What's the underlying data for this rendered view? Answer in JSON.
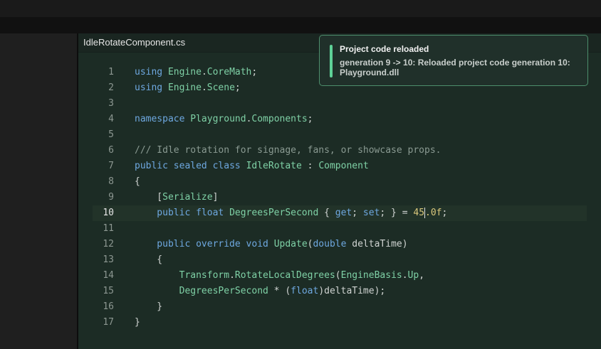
{
  "editor": {
    "tab_title": "IdleRotateComponent.cs",
    "lines": [
      {
        "n": "1",
        "tokens": [
          {
            "t": "using ",
            "c": "kw"
          },
          {
            "t": "Engine",
            "c": "ty"
          },
          {
            "t": ".",
            "c": "pl"
          },
          {
            "t": "CoreMath",
            "c": "ty"
          },
          {
            "t": ";",
            "c": "pl"
          }
        ]
      },
      {
        "n": "2",
        "tokens": [
          {
            "t": "using ",
            "c": "kw"
          },
          {
            "t": "Engine",
            "c": "ty"
          },
          {
            "t": ".",
            "c": "pl"
          },
          {
            "t": "Scene",
            "c": "ty"
          },
          {
            "t": ";",
            "c": "pl"
          }
        ]
      },
      {
        "n": "3",
        "tokens": []
      },
      {
        "n": "4",
        "tokens": [
          {
            "t": "namespace ",
            "c": "kw"
          },
          {
            "t": "Playground",
            "c": "ty"
          },
          {
            "t": ".",
            "c": "pl"
          },
          {
            "t": "Components",
            "c": "ty"
          },
          {
            "t": ";",
            "c": "pl"
          }
        ]
      },
      {
        "n": "5",
        "tokens": []
      },
      {
        "n": "6",
        "tokens": [
          {
            "t": "/// Idle rotation for signage, fans, or showcase props.",
            "c": "cm"
          }
        ]
      },
      {
        "n": "7",
        "tokens": [
          {
            "t": "public ",
            "c": "kw"
          },
          {
            "t": "sealed ",
            "c": "kw"
          },
          {
            "t": "class ",
            "c": "kw"
          },
          {
            "t": "IdleRotate",
            "c": "ty"
          },
          {
            "t": " : ",
            "c": "pl"
          },
          {
            "t": "Component",
            "c": "ty"
          }
        ]
      },
      {
        "n": "8",
        "tokens": [
          {
            "t": "{",
            "c": "pl"
          }
        ]
      },
      {
        "n": "9",
        "tokens": [
          {
            "t": "    [",
            "c": "pl"
          },
          {
            "t": "Serialize",
            "c": "ty"
          },
          {
            "t": "]",
            "c": "pl"
          }
        ]
      },
      {
        "n": "10",
        "active": true,
        "tokens": [
          {
            "t": "    public ",
            "c": "kw"
          },
          {
            "t": "float ",
            "c": "kw"
          },
          {
            "t": "DegreesPerSecond",
            "c": "ty"
          },
          {
            "t": " { ",
            "c": "pl"
          },
          {
            "t": "get",
            "c": "kw"
          },
          {
            "t": "; ",
            "c": "pl"
          },
          {
            "t": "set",
            "c": "kw"
          },
          {
            "t": "; } = ",
            "c": "pl"
          },
          {
            "t": "45",
            "c": "num"
          },
          {
            "t": "|",
            "c": "caret"
          },
          {
            "t": ".0f",
            "c": "num"
          },
          {
            "t": ";",
            "c": "pl"
          }
        ]
      },
      {
        "n": "11",
        "tokens": []
      },
      {
        "n": "12",
        "tokens": [
          {
            "t": "    public ",
            "c": "kw"
          },
          {
            "t": "override ",
            "c": "kw"
          },
          {
            "t": "void ",
            "c": "kw"
          },
          {
            "t": "Update",
            "c": "ty"
          },
          {
            "t": "(",
            "c": "pl"
          },
          {
            "t": "double ",
            "c": "kw"
          },
          {
            "t": "deltaTime)",
            "c": "pl"
          }
        ]
      },
      {
        "n": "13",
        "tokens": [
          {
            "t": "    {",
            "c": "pl"
          }
        ]
      },
      {
        "n": "14",
        "tokens": [
          {
            "t": "        ",
            "c": "pl"
          },
          {
            "t": "Transform",
            "c": "ty"
          },
          {
            "t": ".",
            "c": "pl"
          },
          {
            "t": "RotateLocalDegrees",
            "c": "ty"
          },
          {
            "t": "(",
            "c": "pl"
          },
          {
            "t": "EngineBasis",
            "c": "ty"
          },
          {
            "t": ".",
            "c": "pl"
          },
          {
            "t": "Up",
            "c": "ty"
          },
          {
            "t": ",",
            "c": "pl"
          }
        ]
      },
      {
        "n": "15",
        "tokens": [
          {
            "t": "        ",
            "c": "pl"
          },
          {
            "t": "DegreesPerSecond",
            "c": "ty"
          },
          {
            "t": " * (",
            "c": "pl"
          },
          {
            "t": "float",
            "c": "kw"
          },
          {
            "t": ")deltaTime);",
            "c": "pl"
          }
        ]
      },
      {
        "n": "16",
        "tokens": [
          {
            "t": "    }",
            "c": "pl"
          }
        ]
      },
      {
        "n": "17",
        "tokens": [
          {
            "t": "}",
            "c": "pl"
          }
        ]
      }
    ]
  },
  "toast": {
    "title": "Project code reloaded",
    "message": "generation 9 -> 10: Reloaded project code generation 10: Playground.dll"
  }
}
